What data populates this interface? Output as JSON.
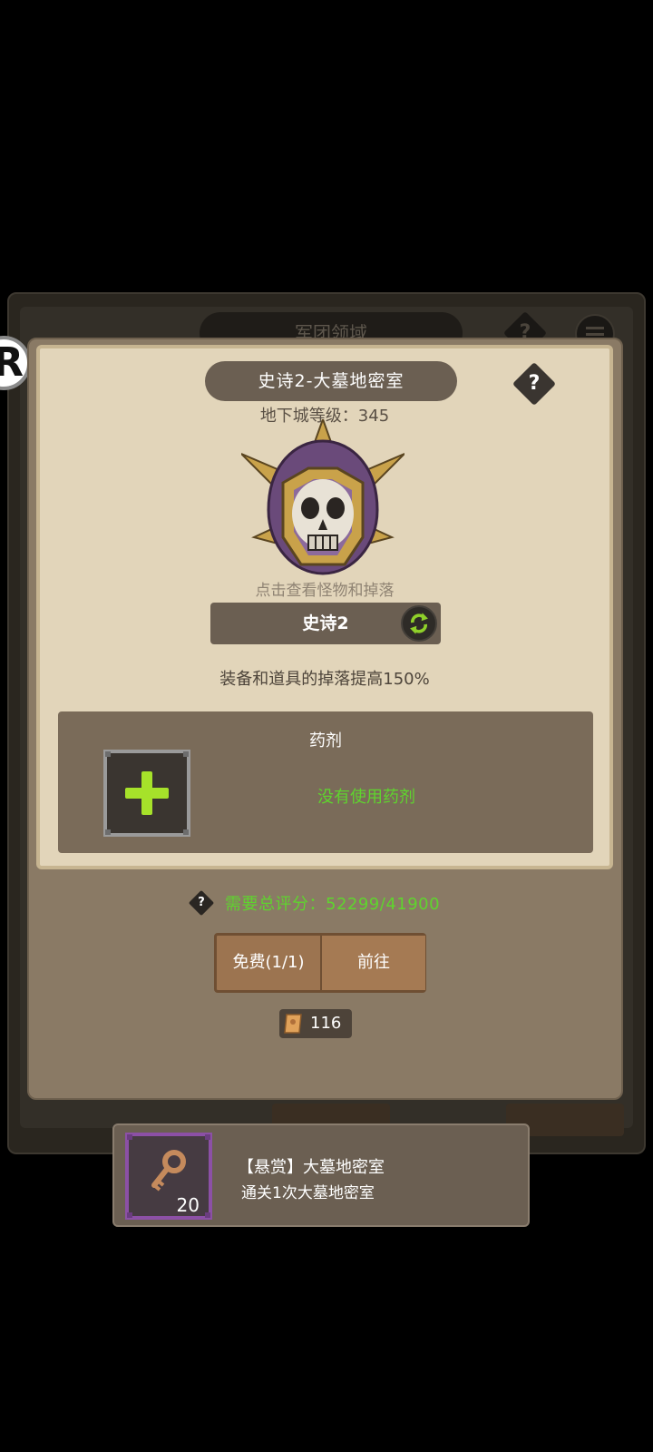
{
  "background": {
    "title": "军团领域",
    "help_label": "?"
  },
  "dungeon": {
    "title": "史诗2-大墓地密室",
    "help_label": "?",
    "level_text": "地下城等级：345",
    "hint": "点击查看怪物和掉落",
    "difficulty_label": "史诗2",
    "drop_bonus": "装备和道具的掉落提高150%"
  },
  "potion": {
    "title": "药剂",
    "status": "没有使用药剂"
  },
  "requirement": {
    "help_label": "?",
    "score_text": "需要总评分：52299/41900"
  },
  "actions": {
    "free_label": "免费(1/1)",
    "go_label": "前往"
  },
  "cost": {
    "icon": "scroll-icon",
    "value": "116"
  },
  "quest": {
    "icon": "key-icon",
    "count": "20",
    "title": "【悬赏】大墓地密室",
    "description": "通关1次大墓地密室"
  },
  "colors": {
    "accent_green": "#5fd42e",
    "plus_green": "#a6e22a",
    "parchment": "#e2d5ba",
    "panel_brown": "#8a7a65"
  }
}
